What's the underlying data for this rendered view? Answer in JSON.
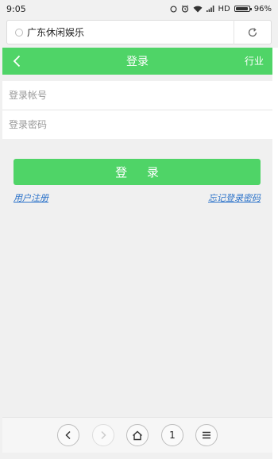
{
  "status_bar": {
    "time": "9:05",
    "network": "HD",
    "battery": "96%",
    "battery_level": 0.96
  },
  "address_bar": {
    "url_text": "广东休闲娱乐",
    "refresh_icon": "refresh-icon"
  },
  "header": {
    "title": "登录",
    "right_label": "行业",
    "back_icon": "chevron-left-icon",
    "color": "#4fd467"
  },
  "form": {
    "account_placeholder": "登录帐号",
    "password_placeholder": "登录密码"
  },
  "login_button": {
    "label": "登 录",
    "color": "#4fd467"
  },
  "links": {
    "register": "用户注册",
    "forgot_password": "忘记登录密码",
    "color": "#2b72c9"
  },
  "bottom_nav": {
    "tab_count": "1",
    "icons": [
      "back-icon",
      "forward-icon",
      "home-icon",
      "tabs-icon",
      "menu-icon"
    ]
  }
}
